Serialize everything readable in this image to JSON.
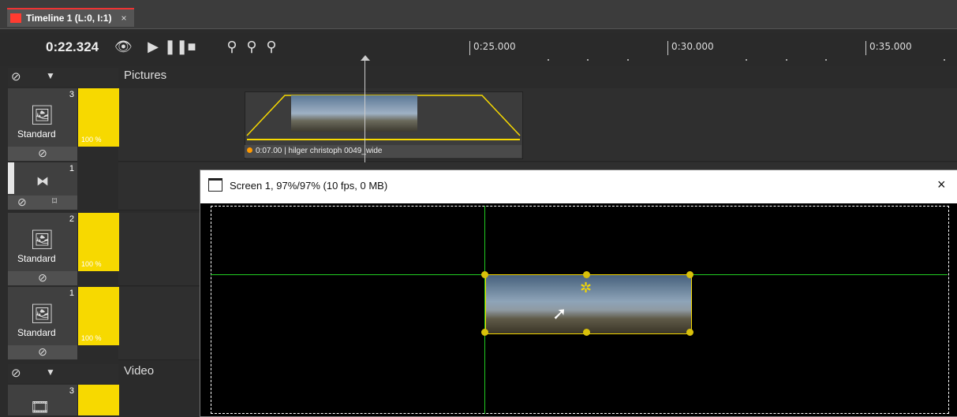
{
  "tab": {
    "title": "Timeline 1 (L:0, I:1)",
    "close": "×"
  },
  "toolbar": {
    "time": "0:22.324"
  },
  "ruler": [
    "0:25.000",
    "0:30.000",
    "0:35.000"
  ],
  "groups": {
    "pictures": "Pictures",
    "video": "Video"
  },
  "tracks": [
    {
      "num": "3",
      "label": "Standard",
      "pct": "100 %"
    },
    {
      "num": "1"
    },
    {
      "num": "2",
      "label": "Standard",
      "pct": "100 %"
    },
    {
      "num": "1",
      "label": "Standard",
      "pct": "100 %"
    },
    {
      "num": "3"
    }
  ],
  "clip": {
    "label": "0:07.00 | hilger christoph 0049_wide"
  },
  "screen": {
    "title": "Screen 1, 97%/97% (10 fps, 0 MB)",
    "close": "×"
  },
  "colors": {
    "accent": "#f7d900",
    "guide": "#22cc22",
    "tab_red": "#ff3b30"
  }
}
